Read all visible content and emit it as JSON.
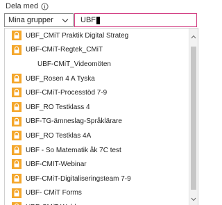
{
  "share": {
    "label": "Dela med",
    "info_icon": "info-icon"
  },
  "group_select": {
    "value": "Mina grupper",
    "icon": "chevron-down-icon"
  },
  "search": {
    "value": "UBF"
  },
  "colors": {
    "lock_orange": "#f4a62a",
    "search_border": "#d23f83"
  },
  "results": [
    {
      "label": "UBF_CMiT Praktik Digital Strateg",
      "icon": "lock-icon"
    },
    {
      "label": "UBF-CMiT-Regtek_CMiT",
      "icon": "lock-icon"
    },
    {
      "label": "UBF-CMiT_Videomöten",
      "icon": ""
    },
    {
      "label": "UBF_Rosen 4 A Tyska",
      "icon": "lock-icon"
    },
    {
      "label": "UBF-CMiT-Processtöd 7-9",
      "icon": "lock-icon"
    },
    {
      "label": "UBF_RO Testklass 4",
      "icon": "lock-icon"
    },
    {
      "label": "UBF-TG-ämneslag-Språklärare",
      "icon": "lock-icon"
    },
    {
      "label": "UBF_RO Testklas 4A",
      "icon": "lock-icon"
    },
    {
      "label": "UBF - So Matematik åk 7C test",
      "icon": "lock-icon"
    },
    {
      "label": "UBF-CMIT-Webinar",
      "icon": "lock-icon"
    },
    {
      "label": "UBF-CMiT-Digitaliseringsteam 7-9",
      "icon": "lock-icon"
    },
    {
      "label": "UBF- CMiT Forms",
      "icon": "lock-icon"
    },
    {
      "label": "UBF-CMiT-Webb...",
      "icon": "lock-icon"
    }
  ]
}
